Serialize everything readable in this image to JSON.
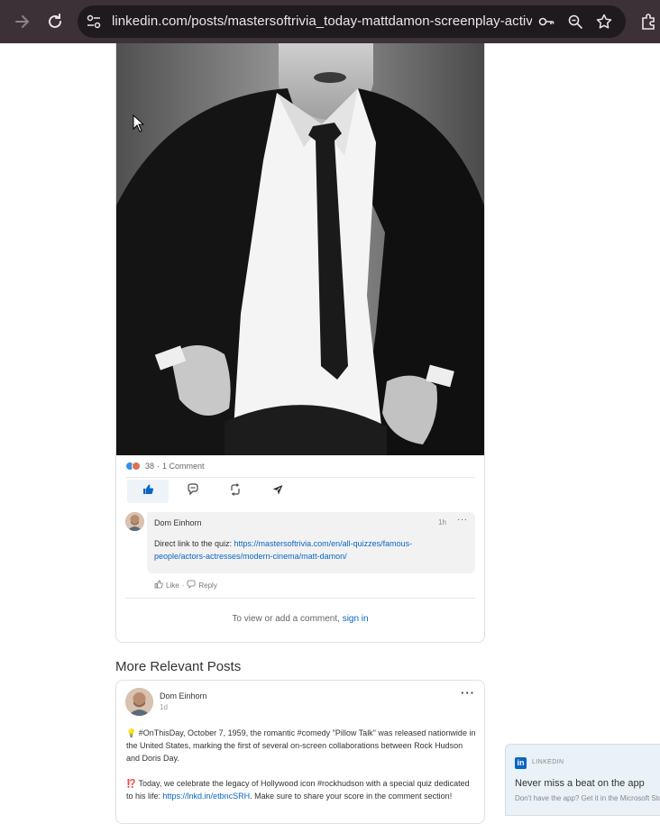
{
  "browser": {
    "url": "linkedin.com/posts/mastersoftrivia_today-mattdamon-screenplay-activity...",
    "icons": [
      "arrow-forward-icon",
      "reload-icon",
      "site-settings-icon",
      "key-icon",
      "zoom-icon",
      "star-icon",
      "extensions-icon"
    ]
  },
  "post": {
    "reaction_count": "38",
    "comment_count": "1 Comment",
    "separator": "·",
    "colors": {
      "like": "#378fe9",
      "love": "#df704d",
      "link": "#0a66c2"
    }
  },
  "comment": {
    "author": "Dom Einhorn",
    "time": "1h",
    "text_prefix": "Direct link to the quiz: ",
    "link": "https://mastersoftrivia.com/en/all-quizzes/famous-people/actors-actresses/modern-cinema/matt-damon/",
    "like_label": "Like",
    "reply_label": "Reply",
    "separator": "·"
  },
  "signin": {
    "text": "To view or add a comment, ",
    "link": "sign in"
  },
  "more_posts": {
    "title": "More Relevant Posts",
    "post": {
      "author": "Dom Einhorn",
      "time": "1d",
      "para1": "💡 #OnThisDay, October 7, 1959, the romantic #comedy \"Pillow Talk\" was released nationwide in the United States, marking the first of several on-screen collaborations between Rock Hudson and Doris Day.",
      "para2_prefix": "⁉️ Today, we celebrate the legacy of Hollywood icon #rockhudson with a special quiz dedicated to his life: ",
      "para2_link": "https://lnkd.in/etbncSRH",
      "para2_suffix": ". Make sure to share your score in the comment section!"
    }
  },
  "toast": {
    "logo": "in",
    "brand": "LINKEDIN",
    "title": "Never miss a beat on the app",
    "subtitle": "Don't have the app? Get it in the Microsoft Store."
  }
}
